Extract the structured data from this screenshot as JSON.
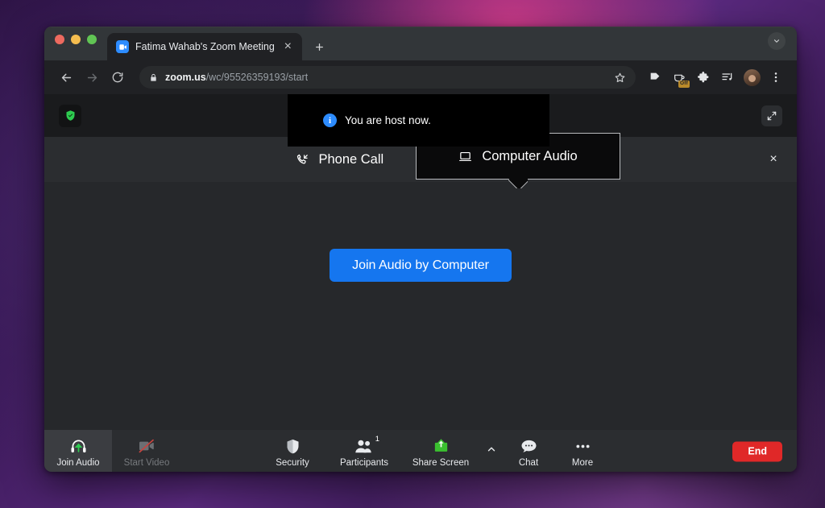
{
  "desktop": {
    "wallpaper_colors": [
      "#2a1140",
      "#5b2a80",
      "#e03e8c",
      "#1e0d30"
    ]
  },
  "browser": {
    "window_controls": {
      "close_label": "close",
      "minimize_label": "minimize",
      "maximize_label": "maximize"
    },
    "tab": {
      "title": "Fatima Wahab's Zoom Meeting",
      "favicon": "zoom-video-icon",
      "close_glyph": "×"
    },
    "new_tab_glyph": "+",
    "tabstrip_caret": "chevron-down-icon",
    "nav": {
      "back": "←",
      "forward": "→",
      "reload": "↻"
    },
    "omnibox": {
      "lock_icon": "lock-icon",
      "url_host": "zoom.us",
      "url_path": "/wc/95526359193/start",
      "star_icon": "bookmark-star-icon"
    },
    "toolbar_icons": [
      {
        "name": "reading-list-icon",
        "badge": ""
      },
      {
        "name": "coffee-off-icon",
        "badge": "Off"
      },
      {
        "name": "extensions-puzzle-icon",
        "badge": ""
      },
      {
        "name": "media-list-icon",
        "badge": ""
      },
      {
        "name": "profile-avatar",
        "badge": ""
      },
      {
        "name": "browser-menu-icon",
        "badge": ""
      }
    ]
  },
  "zoom": {
    "security_shield_icon": "encryption-shield-icon",
    "notification": {
      "icon": "info-icon",
      "icon_glyph": "i",
      "message": "You are host now."
    },
    "expand_icon": "expand-arrows-icon",
    "audio_selector": {
      "phone_tab": {
        "label": "Phone Call",
        "icon": "phone-incoming-icon"
      },
      "computer_tab": {
        "label": "Computer Audio",
        "icon": "laptop-icon",
        "selected": true
      },
      "close_glyph": "×"
    },
    "stage": {
      "join_button_label": "Join Audio by Computer",
      "accent_color": "#1576ef"
    },
    "controls": [
      {
        "label": "Join Audio",
        "icon": "headphones-join-audio-icon",
        "state": "active",
        "badge": ""
      },
      {
        "label": "Start Video",
        "icon": "camera-off-icon",
        "state": "disabled",
        "badge": ""
      },
      {
        "label": "Security",
        "icon": "shield-icon",
        "state": "normal",
        "badge": ""
      },
      {
        "label": "Participants",
        "icon": "participants-icon",
        "state": "normal",
        "badge": "1"
      },
      {
        "label": "Share Screen",
        "icon": "share-screen-icon",
        "state": "normal",
        "badge": ""
      },
      {
        "label": "Chat",
        "icon": "chat-bubble-icon",
        "state": "normal",
        "badge": ""
      },
      {
        "label": "More",
        "icon": "more-dots-icon",
        "state": "normal",
        "badge": ""
      }
    ],
    "share_caret_icon": "chevron-up-icon",
    "end_button": {
      "label": "End",
      "color": "#e02828"
    }
  }
}
